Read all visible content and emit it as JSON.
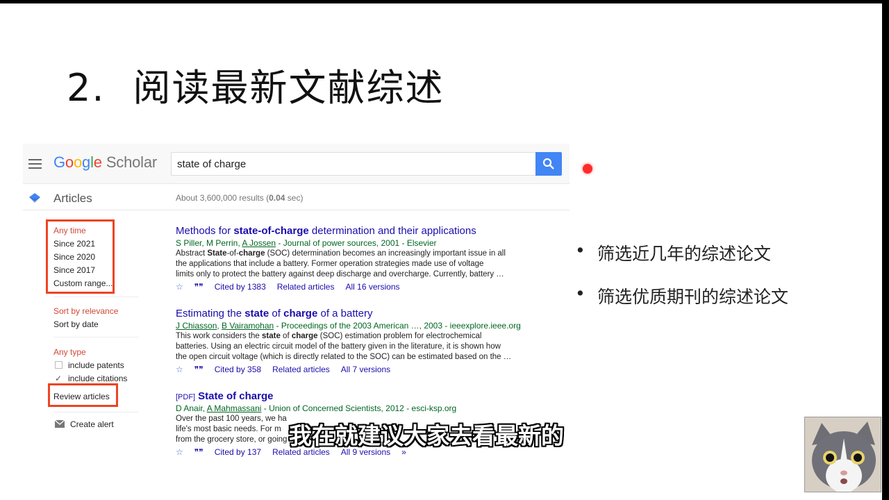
{
  "slide": {
    "number": "2.",
    "title": "阅读最新文献综述"
  },
  "scholar": {
    "logo": {
      "G": "G",
      "o1": "o",
      "o2": "o",
      "g": "g",
      "l": "l",
      "e": "e",
      "scholar": "Scholar"
    },
    "search_value": "state of charge",
    "section_label": "Articles",
    "results_count": "About 3,600,000 results (0.04 sec)",
    "sidebar": {
      "time_options": [
        "Any time",
        "Since 2021",
        "Since 2020",
        "Since 2017",
        "Custom range..."
      ],
      "sort_options": [
        "Sort by relevance",
        "Sort by date"
      ],
      "type_label": "Any type",
      "include_patents": "include patents",
      "include_citations": "include citations",
      "review_articles": "Review articles",
      "create_alert": "Create alert"
    },
    "results": [
      {
        "title_pre": "Methods for ",
        "title_bold": "state-of-charge",
        "title_post": " determination and their applications",
        "authors_a": "S Piller, M Perrin, ",
        "authors_link": "A Jossen",
        "source": " - Journal of power sources, 2001 - Elsevier",
        "snippet_1a": "Abstract ",
        "snippet_1b": "State",
        "snippet_1c": "-of-",
        "snippet_1d": "charge",
        "snippet_1e": " (SOC) determination becomes an increasingly important issue in all",
        "snippet_2": "the applications that include a battery. Former operation strategies made use of voltage",
        "snippet_3": "limits only to protect the battery against deep discharge and overcharge. Currently, battery …",
        "cited": "Cited by 1383",
        "related": "Related articles",
        "versions": "All 16 versions"
      },
      {
        "title_pre": "Estimating the ",
        "title_bold": "state",
        "title_mid": " of ",
        "title_bold2": "charge",
        "title_post": " of a battery",
        "author_1": "J Chiasson",
        "author_sep": ", ",
        "author_2": "B Vairamohan",
        "source": " - Proceedings of the 2003 American …, 2003 - ieeexplore.ieee.org",
        "snippet_1a": "This work considers the ",
        "snippet_1b": "state",
        "snippet_1c": " of ",
        "snippet_1d": "charge",
        "snippet_1e": " (SOC) estimation problem for electrochemical",
        "snippet_2": "batteries. Using an electric circuit model of the battery given in the literature, it is shown how",
        "snippet_3": "the open circuit voltage (which is directly related to the SOC) can be estimated based on the …",
        "cited": "Cited by 358",
        "related": "Related articles",
        "versions": "All 7 versions"
      },
      {
        "pdf": "[PDF]",
        "title": "State of charge",
        "authors_a": "D Anair, ",
        "authors_link": "A Mahmassani",
        "source": " - Union of Concerned Scientists, 2012 - esci-ksp.org",
        "snippet_1": "Over the past 100 years, we ha",
        "snippet_2": "life's most basic needs. For m",
        "snippet_3": "from the grocery store, or going",
        "cited": "Cited by 137",
        "related": "Related articles",
        "versions": "All 9 versions"
      }
    ]
  },
  "bullets": [
    "筛选近几年的综述论文",
    "筛选优质期刊的综述论文"
  ],
  "subtitle": "我在就建议大家去看最新的",
  "colors": {
    "highlight_box": "#ee4422",
    "link": "#1a0dab",
    "author": "#006621",
    "search_btn": "#4285f4"
  }
}
